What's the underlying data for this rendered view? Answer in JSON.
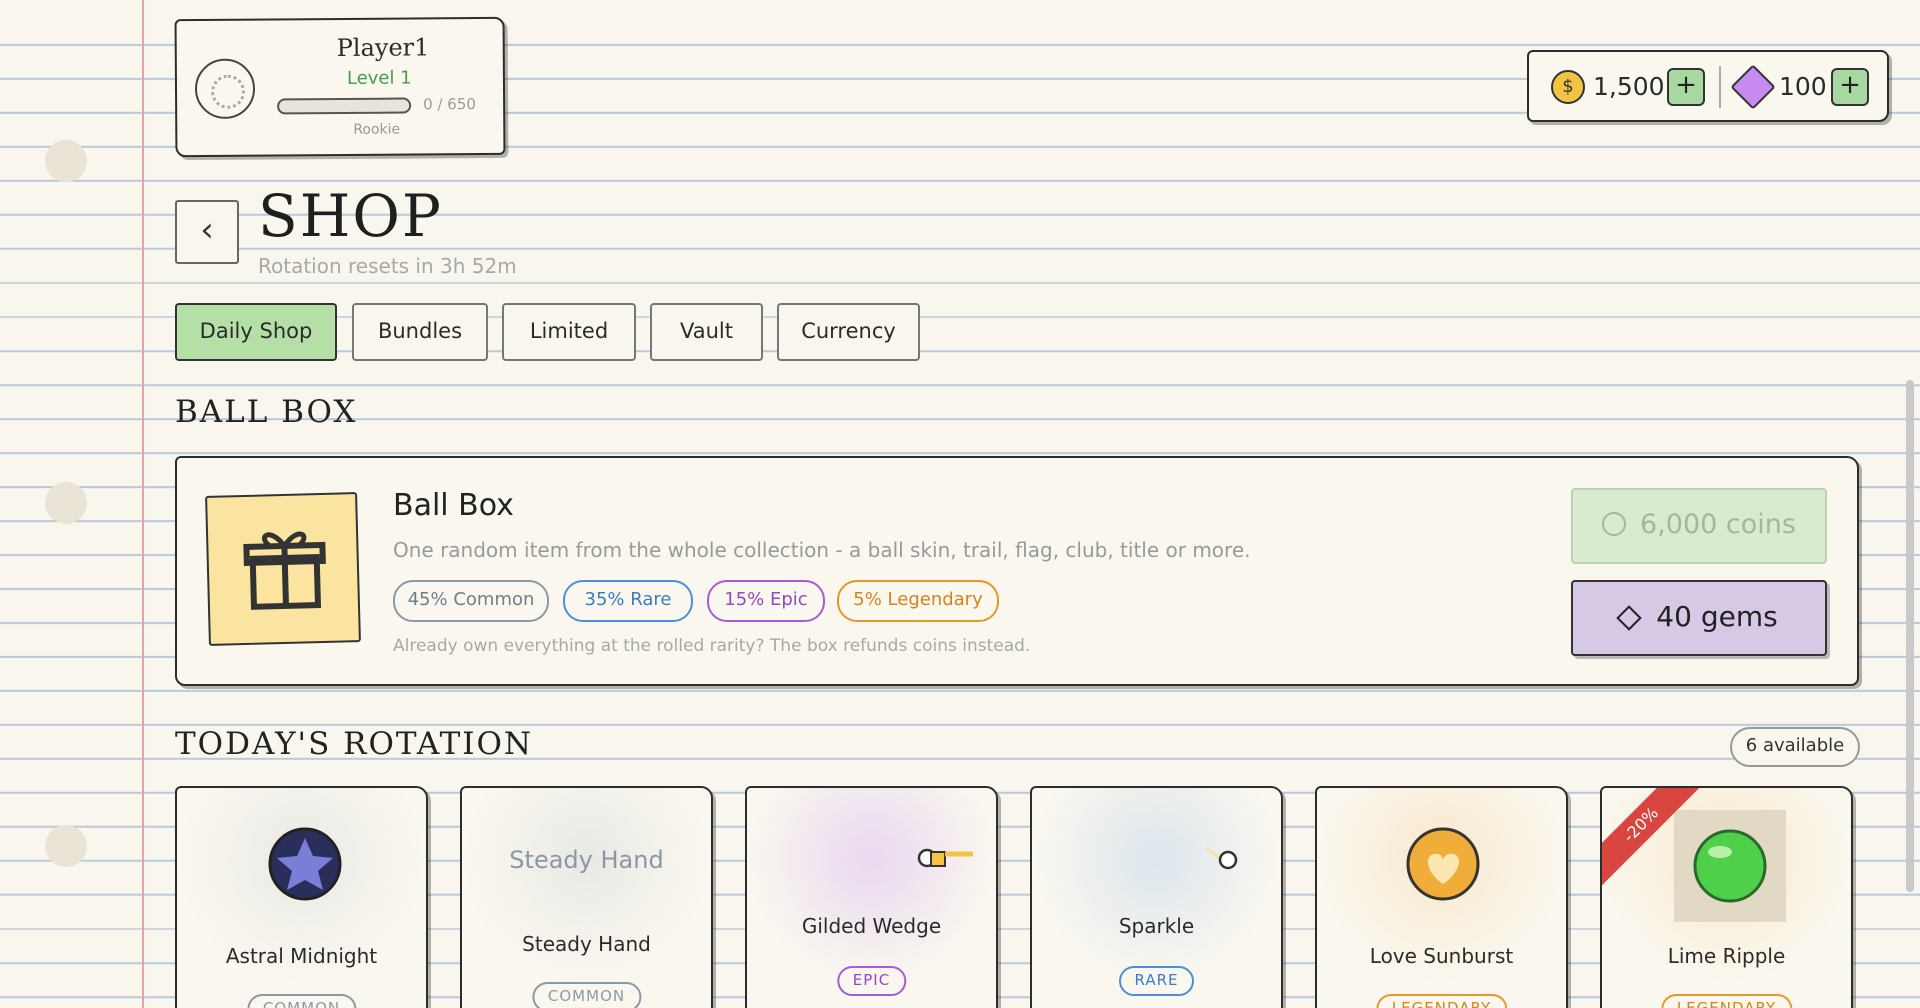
{
  "profile": {
    "name": "Player1",
    "level": "Level 1",
    "xp": "0 / 650",
    "rank": "Rookie"
  },
  "currency": {
    "coin_symbol": "$",
    "coins": "1,500",
    "gems": "100",
    "plus": "+"
  },
  "header": {
    "back": "‹",
    "title": "SHOP",
    "subtitle": "Rotation resets in 3h 52m"
  },
  "tabs": [
    "Daily Shop",
    "Bundles",
    "Limited",
    "Vault",
    "Currency"
  ],
  "ballbox": {
    "section_title": "BALL BOX",
    "name": "Ball Box",
    "description": "One random item from the whole collection - a ball skin, trail, flag, club, title or more.",
    "odds": [
      "45% Common",
      "35% Rare",
      "15% Epic",
      "5% Legendary"
    ],
    "note": "Already own everything at the rolled rarity? The box refunds coins instead.",
    "price_coins": "6,000 coins",
    "price_gems": "40 gems"
  },
  "rotation": {
    "section_title": "TODAY'S ROTATION",
    "available": "6 available",
    "items": [
      {
        "name": "Astral Midnight",
        "rarity": "COMMON"
      },
      {
        "name": "Steady Hand",
        "preview": "Steady Hand",
        "rarity": "COMMON"
      },
      {
        "name": "Gilded Wedge",
        "rarity": "EPIC"
      },
      {
        "name": "Sparkle",
        "rarity": "RARE"
      },
      {
        "name": "Love Sunburst",
        "rarity": "LEGENDARY"
      },
      {
        "name": "Lime Ripple",
        "rarity": "LEGENDARY",
        "discount": "-20%"
      }
    ]
  }
}
